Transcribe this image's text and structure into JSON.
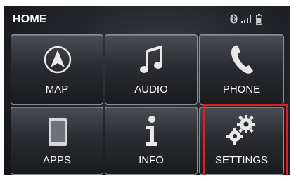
{
  "header": {
    "title": "HOME"
  },
  "status": {
    "icons": [
      "bluetooth-icon",
      "signal-strength-icon",
      "battery-icon"
    ]
  },
  "tiles": [
    {
      "label": "MAP",
      "icon": "navigation-arrow-icon"
    },
    {
      "label": "AUDIO",
      "icon": "music-note-icon"
    },
    {
      "label": "PHONE",
      "icon": "phone-handset-icon"
    },
    {
      "label": "APPS",
      "icon": "tablet-icon"
    },
    {
      "label": "INFO",
      "icon": "info-icon"
    },
    {
      "label": "SETTINGS",
      "icon": "gears-icon"
    }
  ],
  "selected_tile": "SETTINGS",
  "colors": {
    "highlight": "#e01b24",
    "text": "#ffffff"
  }
}
